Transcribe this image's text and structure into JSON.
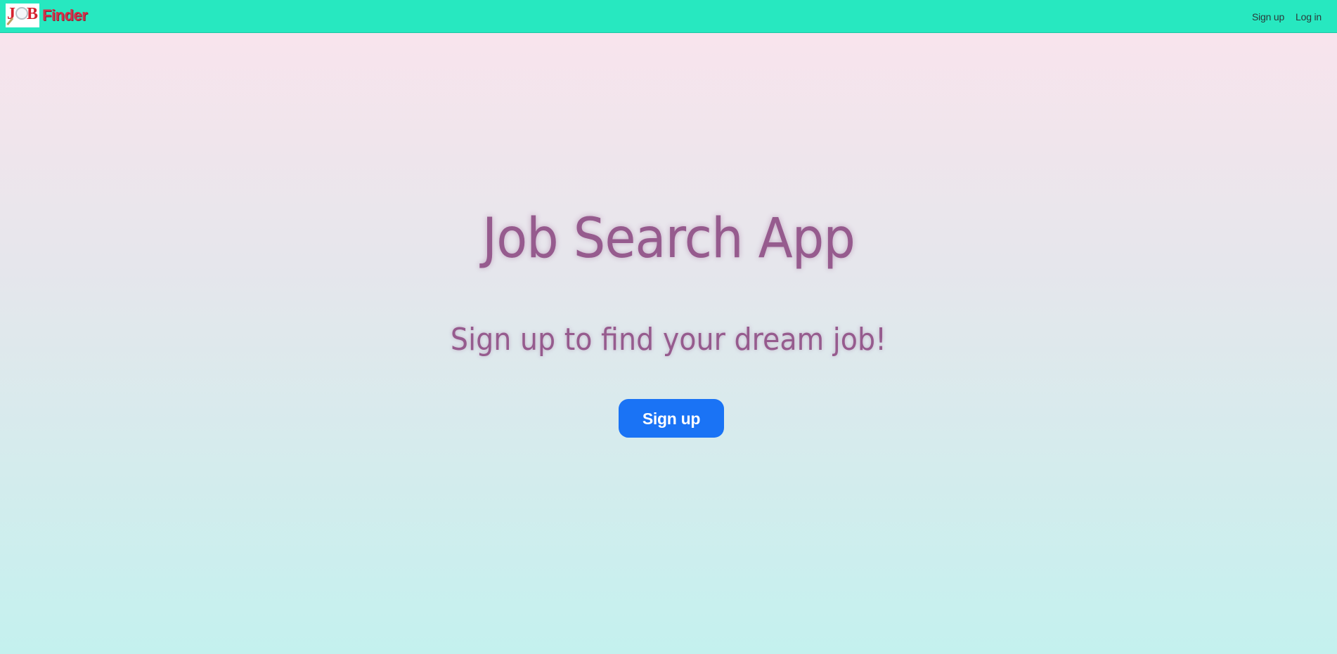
{
  "navbar": {
    "brand": {
      "logo_letters": [
        "J",
        "B"
      ],
      "text": "Finder"
    },
    "links": [
      {
        "label": "Sign up"
      },
      {
        "label": "Log in"
      }
    ],
    "background_color": "#27e8c0"
  },
  "hero": {
    "title": "Job Search App",
    "subtitle": "Sign up to find your dream job!",
    "cta_label": "Sign up",
    "text_color": "#965b8e",
    "button_color": "#1a73f5"
  },
  "icons": {
    "logo": "magnifying-glass-logo-icon"
  }
}
